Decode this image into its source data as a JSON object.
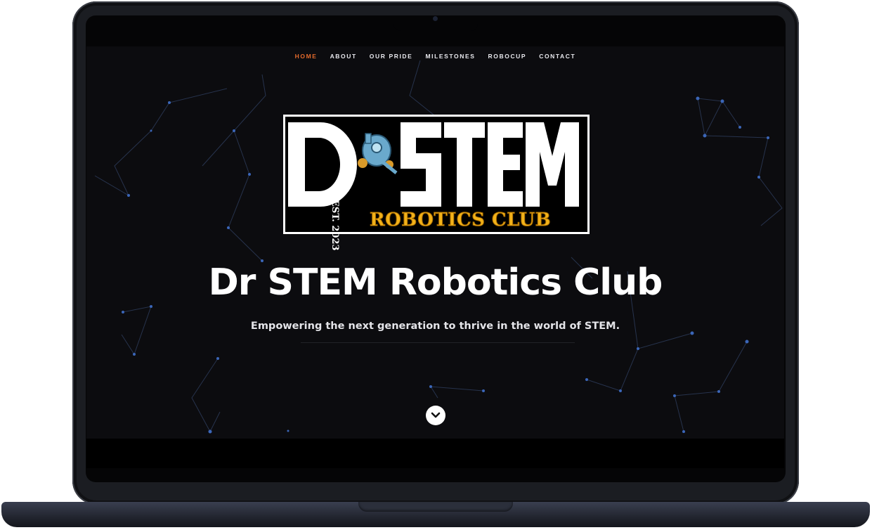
{
  "nav": {
    "items": [
      {
        "label": "HOME",
        "active": true
      },
      {
        "label": "ABOUT",
        "active": false
      },
      {
        "label": "OUR PRIDE",
        "active": false
      },
      {
        "label": "MILESTONES",
        "active": false
      },
      {
        "label": "ROBOCUP",
        "active": false
      },
      {
        "label": "CONTACT",
        "active": false
      }
    ]
  },
  "logo": {
    "letters": "DrSTEM",
    "est": "EST. 2023",
    "subtitle": "ROBOTICS CLUB"
  },
  "hero": {
    "title": "Dr STEM Robotics Club",
    "tagline": "Empowering the next generation to thrive in the world of STEM."
  },
  "scroll_icon": "chevron-down-icon",
  "colors": {
    "accent": "#e36a2c",
    "logo_gold": "#f2b21a",
    "node": "#3b66b8"
  }
}
